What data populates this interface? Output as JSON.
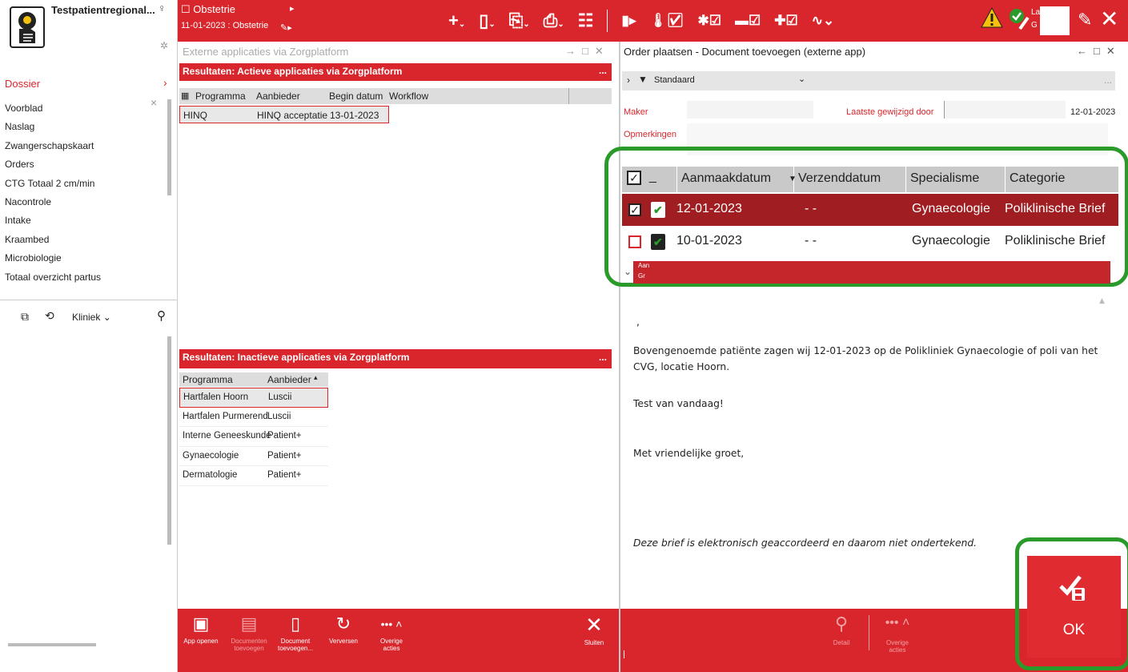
{
  "colors": {
    "brand": "#d9262c",
    "dark": "#a01e22",
    "highlight": "#2a9a2a",
    "warn": "#f4c20d"
  },
  "patient": {
    "name": "Testpatientregional..."
  },
  "topbar": {
    "ctx_title": "Obstetrie",
    "ctx_sub": "11-01-2023 : Obstetrie",
    "right_l1": "La",
    "right_l2": "G"
  },
  "sidebar": {
    "header": "Dossier",
    "items": [
      "Voorblad",
      "Naslag",
      "Zwangerschapskaart",
      "Orders",
      "CTG Totaal 2 cm/min",
      "Nacontrole",
      "Intake",
      "Kraambed",
      "Microbiologie",
      "Totaal overzicht partus"
    ],
    "filter": "Kliniek"
  },
  "mid": {
    "title": "Externe applicaties via Zorgplatform",
    "active": {
      "title": "Resultaten: Actieve applicaties via Zorgplatform",
      "cols": [
        "Programma",
        "Aanbieder",
        "Begin datum",
        "Workflow"
      ],
      "rows": [
        [
          "HINQ",
          "HINQ acceptatie",
          "13-01-2023",
          ""
        ]
      ]
    },
    "inactive": {
      "title": "Resultaten: Inactieve applicaties via Zorgplatform",
      "cols": [
        "Programma",
        "Aanbieder"
      ],
      "rows": [
        [
          "Hartfalen Hoorn",
          "Luscii"
        ],
        [
          "Hartfalen Purmerend",
          "Luscii"
        ],
        [
          "Interne Geneeskunde",
          "Patient+"
        ],
        [
          "Gynaecologie",
          "Patient+"
        ],
        [
          "Dermatologie",
          "Patient+"
        ]
      ]
    },
    "footer": [
      {
        "l1": "App openen",
        "l2": ""
      },
      {
        "l1": "Documenten",
        "l2": "toevoegen"
      },
      {
        "l1": "Document",
        "l2": "toevoegen..."
      },
      {
        "l1": "Verversen",
        "l2": ""
      },
      {
        "l1": "Overige",
        "l2": "acties"
      }
    ],
    "close": "Sluiten"
  },
  "right": {
    "title": "Order plaatsen - Document toevoegen (externe app)",
    "filter": "Standaard",
    "maker_label": "Maker",
    "gewijzigd_label": "Laatste gewijzigd door",
    "gewijzigd_date": "12-01-2023",
    "opm_label": "Opmerkingen",
    "cols": [
      "Aanmaakdatum",
      "Verzenddatum",
      "Specialisme",
      "Categorie"
    ],
    "rows": [
      {
        "checked": true,
        "date": "12-01-2023",
        "sent": "- -",
        "spec": "Gynaecologie",
        "cat": "Poliklinische Brief"
      },
      {
        "checked": false,
        "date": "10-01-2023",
        "sent": "- -",
        "spec": "Gynaecologie",
        "cat": "Poliklinische Brief"
      }
    ],
    "sub_l1": "Aan",
    "sub_l2": "Gr",
    "comma": ",",
    "letter": {
      "p1": "Bovengenoemde patiënte zagen wij 12-01-2023 op de Polikliniek Gynaecologie of poli van het CVG, locatie Hoorn.",
      "p2": "Test van vandaag!",
      "p3": "Met vriendelijke groet,",
      "p4": "Deze brief is elektronisch geaccordeerd en daarom niet ondertekend."
    },
    "footer": {
      "detail": "Detail",
      "overige_l1": "Overige",
      "overige_l2": "acties"
    },
    "ok": "OK"
  }
}
